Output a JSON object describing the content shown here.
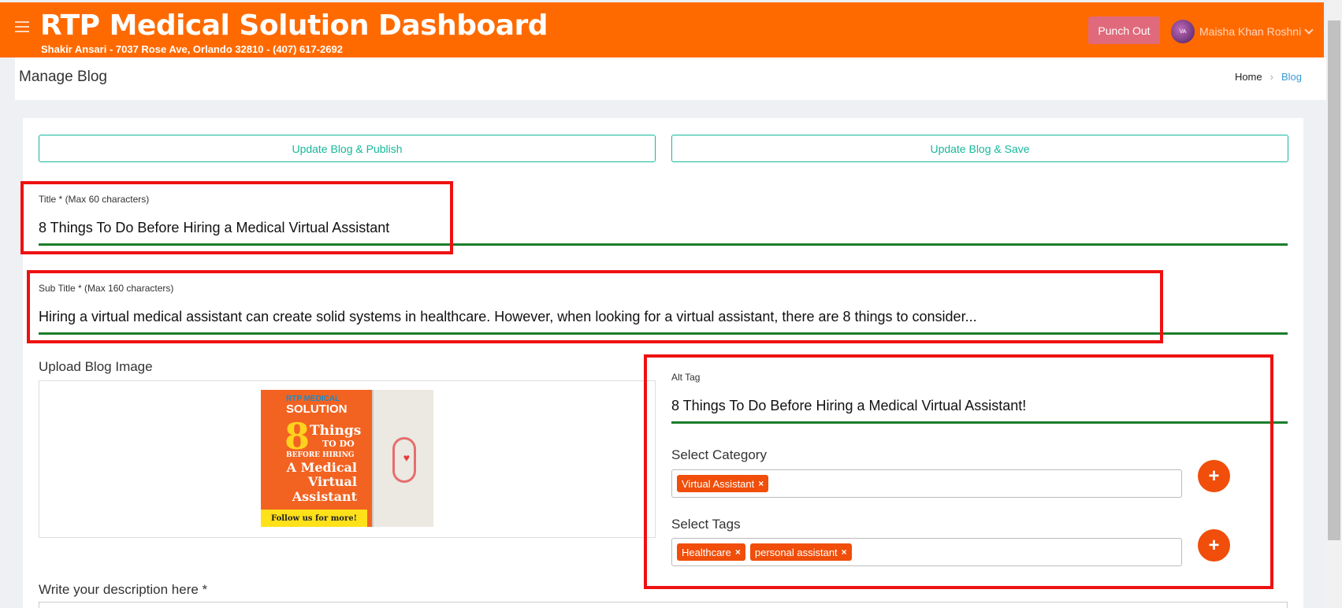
{
  "header": {
    "title": "RTP Medical Solution Dashboard",
    "subtitle": "Shakir Ansari - 7037 Rose Ave, Orlando 32810 - (407) 617-2692",
    "punch_out_label": "Punch Out",
    "user_name": "Maisha Khan Roshni",
    "avatar_text": "VA"
  },
  "page": {
    "title": "Manage Blog",
    "breadcrumb": {
      "home": "Home",
      "current": "Blog"
    }
  },
  "actions": {
    "publish_label": "Update Blog & Publish",
    "save_label": "Update Blog & Save"
  },
  "form": {
    "title_label": "Title * (Max 60 characters)",
    "title_value": "8 Things To Do Before Hiring a Medical Virtual Assistant",
    "subtitle_label": "Sub Title * (Max 160 characters)",
    "subtitle_value": "Hiring a virtual medical assistant can create solid systems in healthcare. However, when looking for a virtual assistant, there are 8 things to consider...",
    "upload_label": "Upload Blog Image",
    "alt_label": "Alt Tag",
    "alt_value": "8 Things To Do Before Hiring a Medical Virtual Assistant!",
    "category_label": "Select Category",
    "categories": [
      "Virtual Assistant"
    ],
    "tags_label": "Select Tags",
    "tags": [
      "Healthcare",
      "personal assistant"
    ],
    "description_label": "Write your description here *"
  },
  "blog_image": {
    "line1": "RTP MEDICAL",
    "line2": "SOLUTION",
    "line3": "8",
    "line4": "Things",
    "line5": "TO DO",
    "line6": "BEFORE HIRING",
    "line7": "A Medical Virtual Assistant",
    "footer": "Follow us for more!"
  },
  "icons": {
    "remove": "×",
    "add": "+"
  },
  "colors": {
    "header_bg": "#ff6a00",
    "accent_green": "#15b89a",
    "underline": "#1a7d2a",
    "chip": "#f04e0a",
    "highlight": "#ee1111"
  }
}
